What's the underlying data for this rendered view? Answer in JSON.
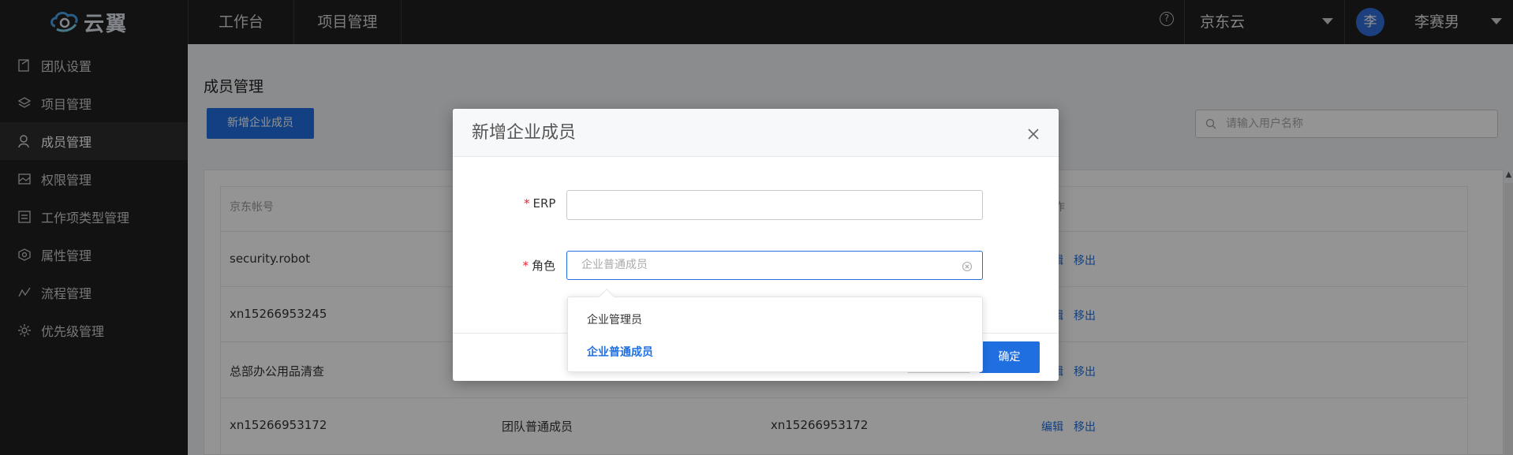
{
  "app": {
    "logo_text": "云翼"
  },
  "topnav": {
    "tabs": [
      {
        "label": "工作台"
      },
      {
        "label": "项目管理"
      }
    ],
    "help_glyph": "?",
    "tenant": "京东云",
    "avatar_char": "李",
    "user": "李赛男"
  },
  "sidebar": {
    "items": [
      {
        "label": "团队设置",
        "icon": "team-icon"
      },
      {
        "label": "项目管理",
        "icon": "layers-icon"
      },
      {
        "label": "成员管理",
        "icon": "user-icon",
        "active": true
      },
      {
        "label": "权限管理",
        "icon": "image-icon"
      },
      {
        "label": "工作项类型管理",
        "icon": "list-icon"
      },
      {
        "label": "属性管理",
        "icon": "box-icon"
      },
      {
        "label": "流程管理",
        "icon": "flow-icon"
      },
      {
        "label": "优先级管理",
        "icon": "gear-icon"
      }
    ]
  },
  "main": {
    "title": "成员管理",
    "add_button": "新增企业成员",
    "search_placeholder": "请输入用户名称",
    "table": {
      "headers": [
        "京东帐号",
        "作"
      ],
      "rows": [
        {
          "account": "security.robot",
          "role": "",
          "erp": "",
          "actions": [
            "编辑",
            "移出"
          ]
        },
        {
          "account": "xn15266953245",
          "role": "",
          "erp": "",
          "actions": [
            "编辑",
            "移出"
          ]
        },
        {
          "account": "总部办公用品清查",
          "role": "",
          "erp": "",
          "actions": [
            "编辑",
            "移出"
          ]
        },
        {
          "account": "xn15266953172",
          "role": "团队普通成员",
          "erp": "xn15266953172",
          "actions": [
            "编辑",
            "移出"
          ]
        }
      ]
    }
  },
  "modal": {
    "title": "新增企业成员",
    "fields": {
      "erp": {
        "required_mark": "*",
        "label": "ERP",
        "value": ""
      },
      "role": {
        "required_mark": "*",
        "label": "角色",
        "placeholder": "企业普通成员"
      }
    },
    "ok_label": "确定",
    "dropdown": {
      "options": [
        {
          "label": "企业管理员",
          "selected": false
        },
        {
          "label": "企业普通成员",
          "selected": true
        }
      ]
    }
  },
  "colors": {
    "accent": "#1f6fe0",
    "sidebar_bg": "#1f1f1f"
  }
}
